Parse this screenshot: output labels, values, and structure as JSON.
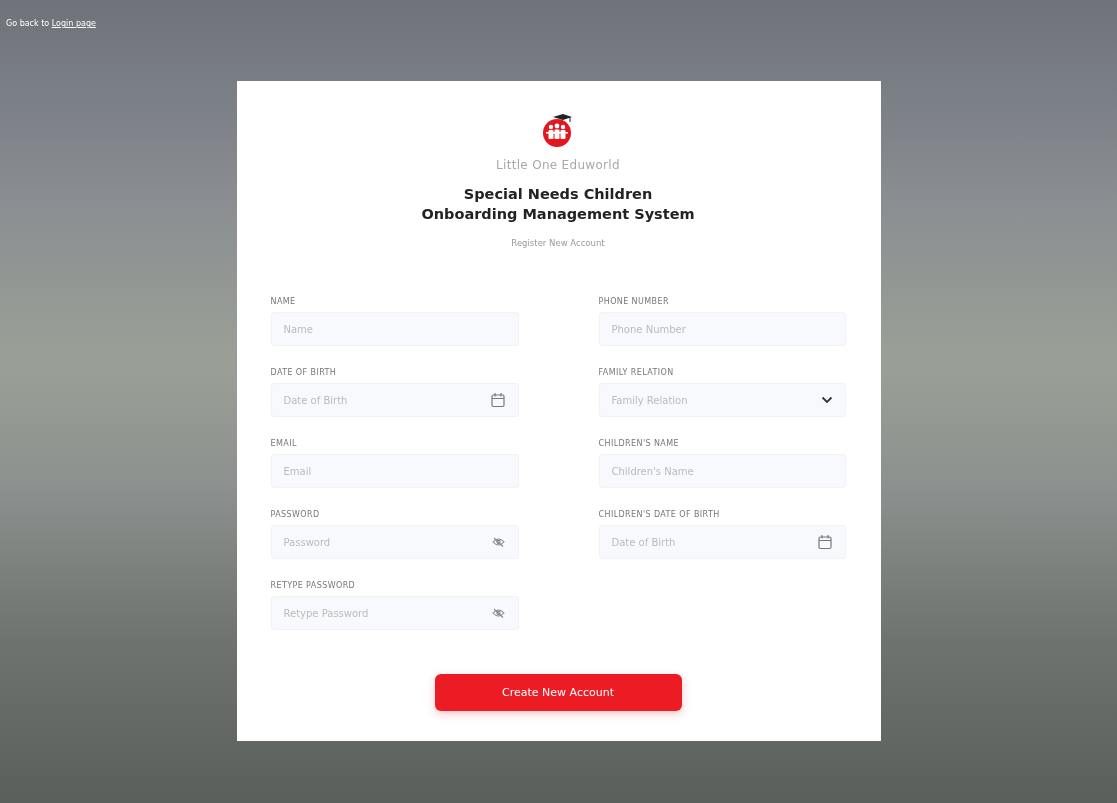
{
  "back_link": {
    "prefix": "Go back to",
    "link": "Login page"
  },
  "brand": {
    "name": "Little One Eduworld"
  },
  "title_lines": [
    "Special Needs Children",
    "Onboarding Management System"
  ],
  "subtitle": "Register New Account",
  "left_fields": [
    {
      "kind": "text",
      "label": "NAME",
      "placeholder": "Name"
    },
    {
      "kind": "date",
      "label": "DATE OF BIRTH",
      "placeholder": "Date of Birth"
    },
    {
      "kind": "text",
      "label": "EMAIL",
      "placeholder": "Email"
    },
    {
      "kind": "password",
      "label": "PASSWORD",
      "placeholder": "Password"
    },
    {
      "kind": "password",
      "label": "RETYPE PASSWORD",
      "placeholder": "Retype Password"
    }
  ],
  "right_fields": [
    {
      "kind": "text",
      "label": "PHONE NUMBER",
      "placeholder": "Phone Number"
    },
    {
      "kind": "select",
      "label": "FAMILY RELATION",
      "placeholder": "Family Relation"
    },
    {
      "kind": "text",
      "label": "CHILDREN'S NAME",
      "placeholder": "Children's Name"
    },
    {
      "kind": "date",
      "label": "CHILDREN'S DATE OF BIRTH",
      "placeholder": "Date of Birth"
    }
  ],
  "submit_button": "Create New Account"
}
